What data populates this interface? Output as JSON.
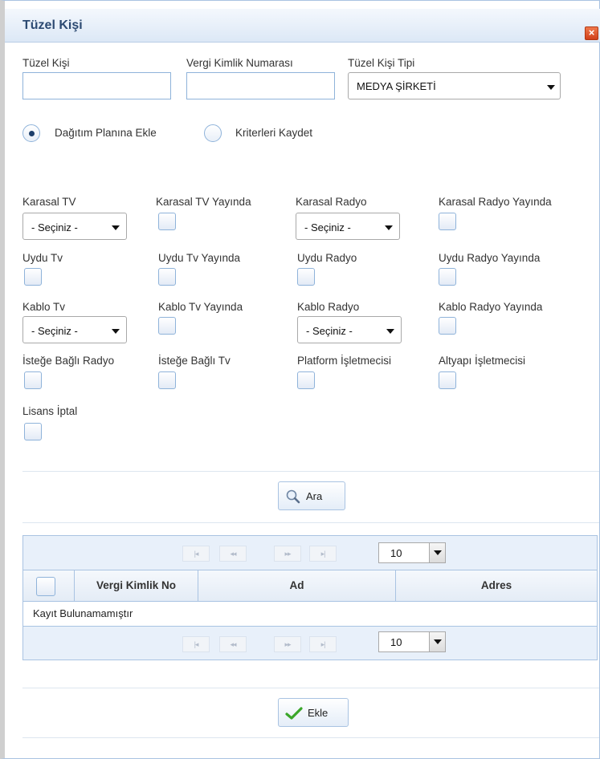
{
  "dialog": {
    "title": "Tüzel Kişi",
    "close_symbol": "×"
  },
  "form": {
    "tuzel_kisi_label": "Tüzel Kişi",
    "tuzel_kisi_value": "",
    "vergi_label": "Vergi Kimlik Numarası",
    "vergi_value": "",
    "tip_label": "Tüzel Kişi Tipi",
    "tip_value": "MEDYA ŞİRKETİ"
  },
  "radios": {
    "dagitim_label": "Dağıtım Planına Ekle",
    "dagitim_selected": true,
    "kriter_label": "Kriterleri Kaydet",
    "kriter_selected": false
  },
  "criteria": {
    "karasal_tv": "Karasal TV",
    "karasal_tv_value": "- Seçiniz -",
    "karasal_tv_yayinda": "Karasal TV Yayında",
    "karasal_radyo": "Karasal Radyo",
    "karasal_radyo_value": "- Seçiniz -",
    "karasal_radyo_yayinda": "Karasal Radyo Yayında",
    "uydu_tv": "Uydu Tv",
    "uydu_tv_yayinda": "Uydu Tv Yayında",
    "uydu_radyo": "Uydu Radyo",
    "uydu_radyo_yayinda": "Uydu Radyo Yayında",
    "kablo_tv": "Kablo Tv",
    "kablo_tv_value": "- Seçiniz -",
    "kablo_tv_yayinda": "Kablo Tv Yayında",
    "kablo_radyo": "Kablo Radyo",
    "kablo_radyo_value": "- Seçiniz -",
    "kablo_radyo_yayinda": "Kablo Radyo Yayında",
    "istege_bagli_radyo": "İsteğe Bağlı Radyo",
    "istege_bagli_tv": "İsteğe Bağlı Tv",
    "platform_isletmecisi": "Platform İşletmecisi",
    "altyapi_isletmecisi": "Altyapı İşletmecisi",
    "lisans_iptal": "Lisans İptal"
  },
  "search_button": {
    "label": "Ara",
    "icon": "magnifier-icon"
  },
  "grid": {
    "page_size": "10",
    "pager_first": "|◂",
    "pager_prev": "◂◂",
    "pager_next": "▸▸",
    "pager_last": "▸|",
    "columns": [
      "Vergi Kimlik No",
      "Ad",
      "Adres"
    ],
    "empty_message": "Kayıt Bulunamamıştır"
  },
  "add_button": {
    "label": "Ekle",
    "icon": "checkmark-icon"
  },
  "colors": {
    "title_text": "#2c4a72",
    "close_button": "#d0401b",
    "border_accent": "#a9c3e2",
    "check_green": "#3aa62a"
  }
}
